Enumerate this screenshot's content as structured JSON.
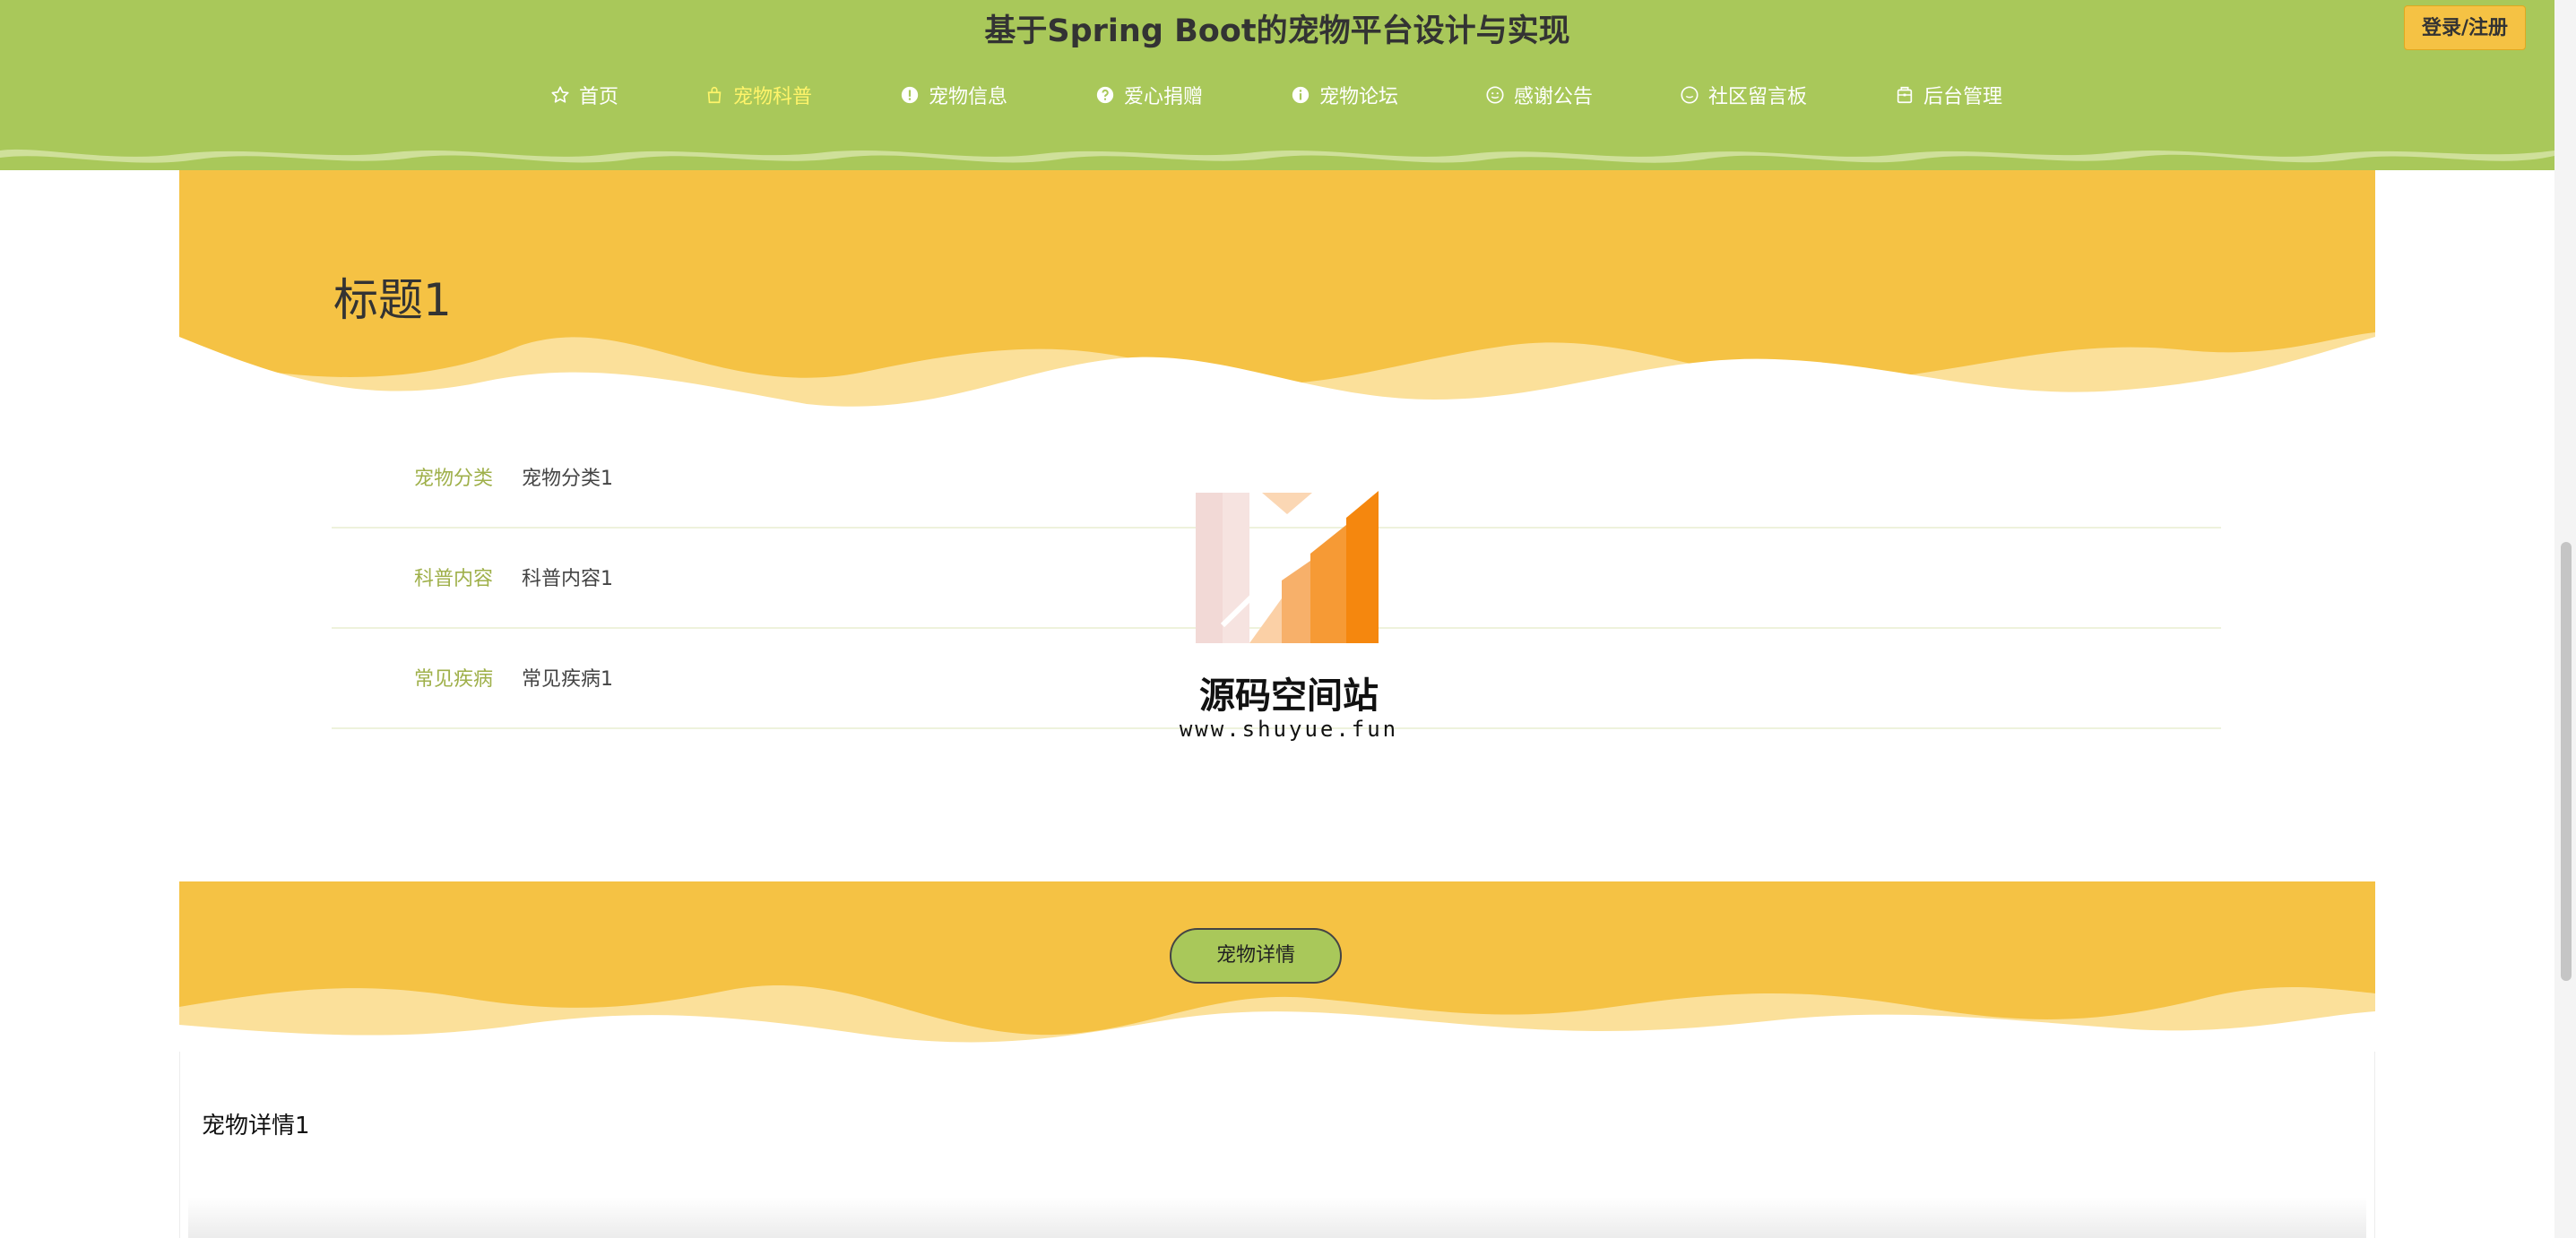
{
  "header": {
    "site_title": "基于Spring Boot的宠物平台设计与实现",
    "login_label": "登录/注册",
    "nav": [
      {
        "label": "首页",
        "icon": "star-icon"
      },
      {
        "label": "宠物科普",
        "icon": "bag-icon",
        "active": true
      },
      {
        "label": "宠物信息",
        "icon": "info-icon"
      },
      {
        "label": "爱心捐赠",
        "icon": "question-icon"
      },
      {
        "label": "宠物论坛",
        "icon": "info-icon"
      },
      {
        "label": "感谢公告",
        "icon": "smile-icon"
      },
      {
        "label": "社区留言板",
        "icon": "chat-icon"
      },
      {
        "label": "后台管理",
        "icon": "admin-icon"
      }
    ]
  },
  "detail": {
    "title": "标题1",
    "fields": [
      {
        "label": "宠物分类",
        "value": "宠物分类1"
      },
      {
        "label": "科普内容",
        "value": "科普内容1"
      },
      {
        "label": "常见疾病",
        "value": "常见疾病1"
      }
    ]
  },
  "watermark": {
    "name": "源码空间站",
    "url": "www.shuyue.fun"
  },
  "pet_detail": {
    "button_label": "宠物详情",
    "content": "宠物详情1"
  },
  "colors": {
    "header_green": "#a9c85a",
    "band_yellow": "#f5c244",
    "active_nav": "#fff46a",
    "label_green": "#9fb04a"
  }
}
